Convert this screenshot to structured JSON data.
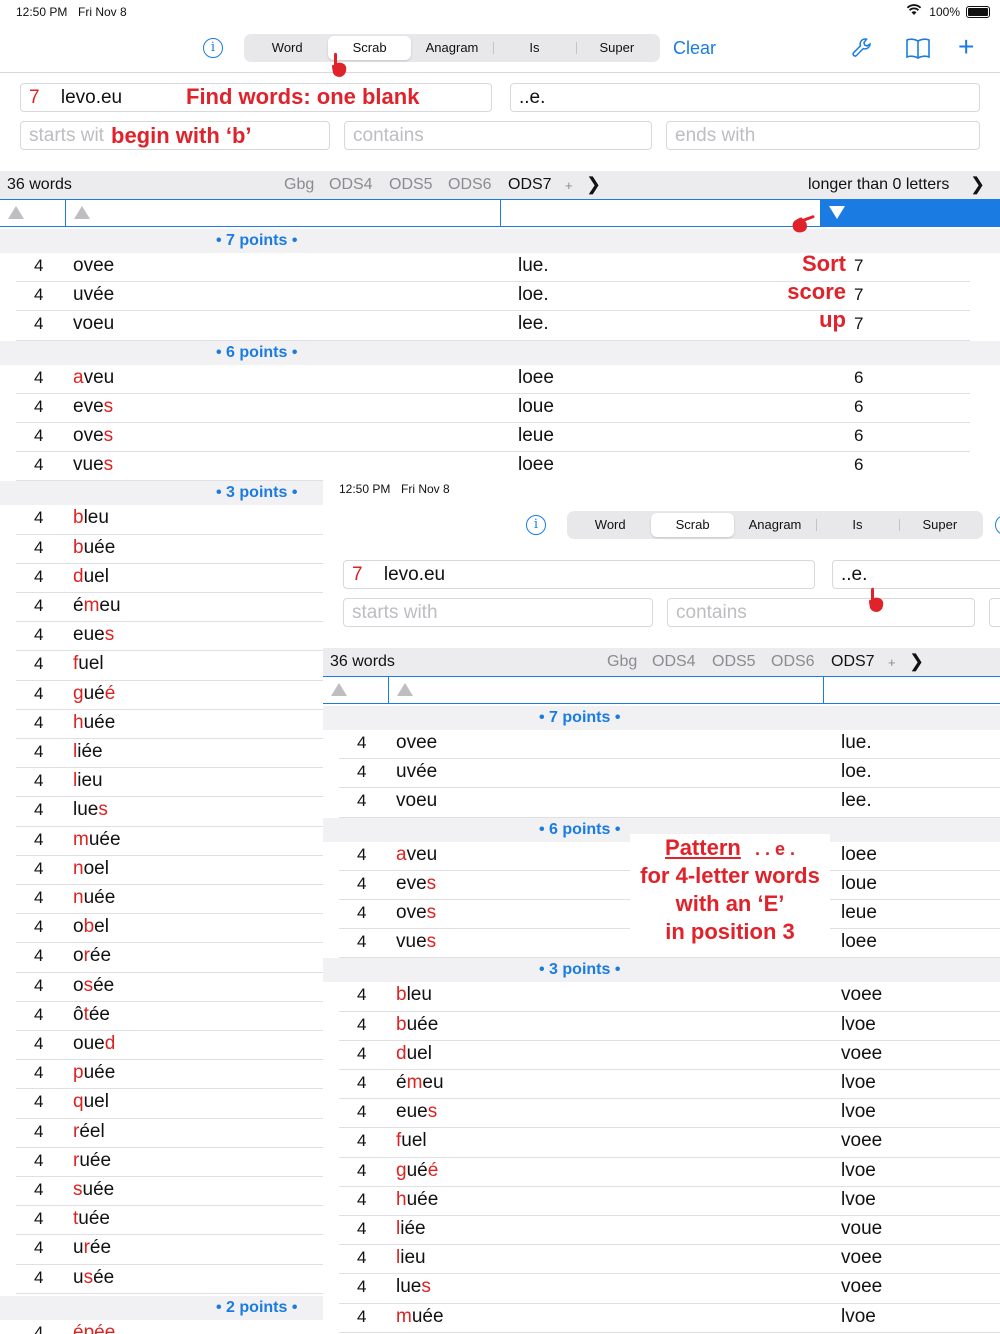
{
  "status": {
    "time": "12:50 PM",
    "date": "Fri Nov 8",
    "battery": "100%"
  },
  "tabs": [
    "Word",
    "Scrab",
    "Anagram",
    "Is",
    "Super"
  ],
  "selected_tab": "Scrab",
  "clear_label": "Clear",
  "icons": {
    "info": "info-icon",
    "wrench": "wrench-icon",
    "book": "book-icon",
    "plus": "plus-icon",
    "wifi": "wifi-icon",
    "battery": "battery-icon",
    "hand": "pointing-hand-icon"
  },
  "letters_count": "7",
  "letters": "levo.eu",
  "pattern": "..e.",
  "placeholders": {
    "starts": "starts with",
    "contains": "contains",
    "ends": "ends with"
  },
  "starts_overlay_prefix": "starts wit",
  "word_count": "36 words",
  "lexicons": [
    "Gbg",
    "ODS4",
    "ODS5",
    "ODS6",
    "ODS7"
  ],
  "lexicon_selected": "ODS7",
  "lexicon_plus": "+",
  "length_filter": "longer than 0 letters",
  "sections": {
    "s7": "• 7 points •",
    "s6": "• 6 points •",
    "s3": "• 3 points •",
    "s2": "• 2 points •"
  },
  "rowsA": [
    {
      "len": "4",
      "w1": "",
      "w2": "ovee",
      "pat": "lue.",
      "score": "7"
    },
    {
      "len": "4",
      "w1": "",
      "w2": "uvée",
      "pat": "loe.",
      "score": "7"
    },
    {
      "len": "4",
      "w1": "",
      "w2": "voeu",
      "pat": "lee.",
      "score": "7"
    },
    {
      "len": "4",
      "w1": "",
      "w2": "aveu",
      "w3": "",
      "pat": "loee",
      "score": "6",
      "r": "a",
      "rest": "veu"
    },
    {
      "len": "4",
      "pat": "loue",
      "score": "6",
      "pre": "eve",
      "r": "s"
    },
    {
      "len": "4",
      "pat": "leue",
      "score": "6",
      "pre": "ove",
      "r": "s"
    },
    {
      "len": "4",
      "pat": "loee",
      "score": "6",
      "pre": "vue",
      "r": "s"
    }
  ],
  "words7": [
    {
      "len": "4",
      "word": "ovee",
      "pat": "lue.",
      "score": "7"
    },
    {
      "len": "4",
      "word": "uvée",
      "pat": "loe.",
      "score": "7"
    },
    {
      "len": "4",
      "word": "voeu",
      "pat": "lee.",
      "score": "7"
    }
  ],
  "words6": [
    {
      "len": "4",
      "a": "a",
      "b": "veu",
      "c": "",
      "pat": "loee",
      "score": "6"
    },
    {
      "len": "4",
      "a": "",
      "b": "eve",
      "c": "s",
      "pat": "loue",
      "score": "6"
    },
    {
      "len": "4",
      "a": "",
      "b": "ove",
      "c": "s",
      "pat": "leue",
      "score": "6"
    },
    {
      "len": "4",
      "a": "",
      "b": "vue",
      "c": "s",
      "pat": "loee",
      "score": "6"
    }
  ],
  "words3": [
    {
      "len": "4",
      "a": "b",
      "b": "leu",
      "c": ""
    },
    {
      "len": "4",
      "a": "b",
      "b": "uée",
      "c": ""
    },
    {
      "len": "4",
      "a": "d",
      "b": "uel",
      "c": ""
    },
    {
      "len": "4",
      "a": "",
      "b": "é",
      "c": "m",
      "d": "eu"
    },
    {
      "len": "4",
      "a": "",
      "b": "eue",
      "c": "s"
    },
    {
      "len": "4",
      "a": "f",
      "b": "uel",
      "c": ""
    },
    {
      "len": "4",
      "a": "g",
      "b": "ué",
      "c": "",
      "d2": "é"
    },
    {
      "len": "4",
      "a": "h",
      "b": "uée",
      "c": ""
    },
    {
      "len": "4",
      "a": "l",
      "b": "iée",
      "c": ""
    },
    {
      "len": "4",
      "a": "l",
      "b": "ieu",
      "c": ""
    },
    {
      "len": "4",
      "a": "",
      "b": "lue",
      "c": "s"
    },
    {
      "len": "4",
      "a": "m",
      "b": "uée",
      "c": ""
    },
    {
      "len": "4",
      "a": "n",
      "b": "oel",
      "c": ""
    },
    {
      "len": "4",
      "a": "n",
      "b": "uée",
      "c": ""
    },
    {
      "len": "4",
      "a": "",
      "b": "o",
      "c": "b",
      "d": "el"
    },
    {
      "len": "4",
      "a": "",
      "b": "o",
      "c": "r",
      "d": "ée"
    },
    {
      "len": "4",
      "a": "",
      "b": "o",
      "c": "s",
      "d": "ée"
    },
    {
      "len": "4",
      "a": "",
      "b": "ô",
      "c": "t",
      "d": "ée"
    },
    {
      "len": "4",
      "a": "",
      "b": "oue",
      "c": "d"
    },
    {
      "len": "4",
      "a": "p",
      "b": "uée",
      "c": ""
    },
    {
      "len": "4",
      "a": "q",
      "b": "uel",
      "c": ""
    },
    {
      "len": "4",
      "a": "r",
      "b": "éel",
      "c": ""
    },
    {
      "len": "4",
      "a": "r",
      "b": "uée",
      "c": ""
    },
    {
      "len": "4",
      "a": "s",
      "b": "uée",
      "c": ""
    },
    {
      "len": "4",
      "a": "t",
      "b": "uée",
      "c": ""
    },
    {
      "len": "4",
      "a": "",
      "b": "u",
      "c": "r",
      "d": "ée"
    },
    {
      "len": "4",
      "a": "",
      "b": "u",
      "c": "s",
      "d": "ée"
    }
  ],
  "pats3B": [
    "voee",
    "lvoe",
    "voee",
    "lvoe",
    "lvoe",
    "voee",
    "lvoe",
    "lvoe",
    "voue",
    "voee",
    "voee",
    "lvoe"
  ],
  "words2": [
    {
      "len": "4",
      "a": "é",
      "b": "p",
      "c": "ée"
    }
  ],
  "annotations": {
    "find": "Find words: one blank",
    "begin": "begin with ‘b’",
    "sort1": "Sort",
    "sort2": "score",
    "sort3": "up",
    "pat1": "Pattern",
    "pat1b": ". . e .",
    "pat2": "for 4-letter words",
    "pat3": "with an ‘E’",
    "pat4": "in position 3"
  }
}
